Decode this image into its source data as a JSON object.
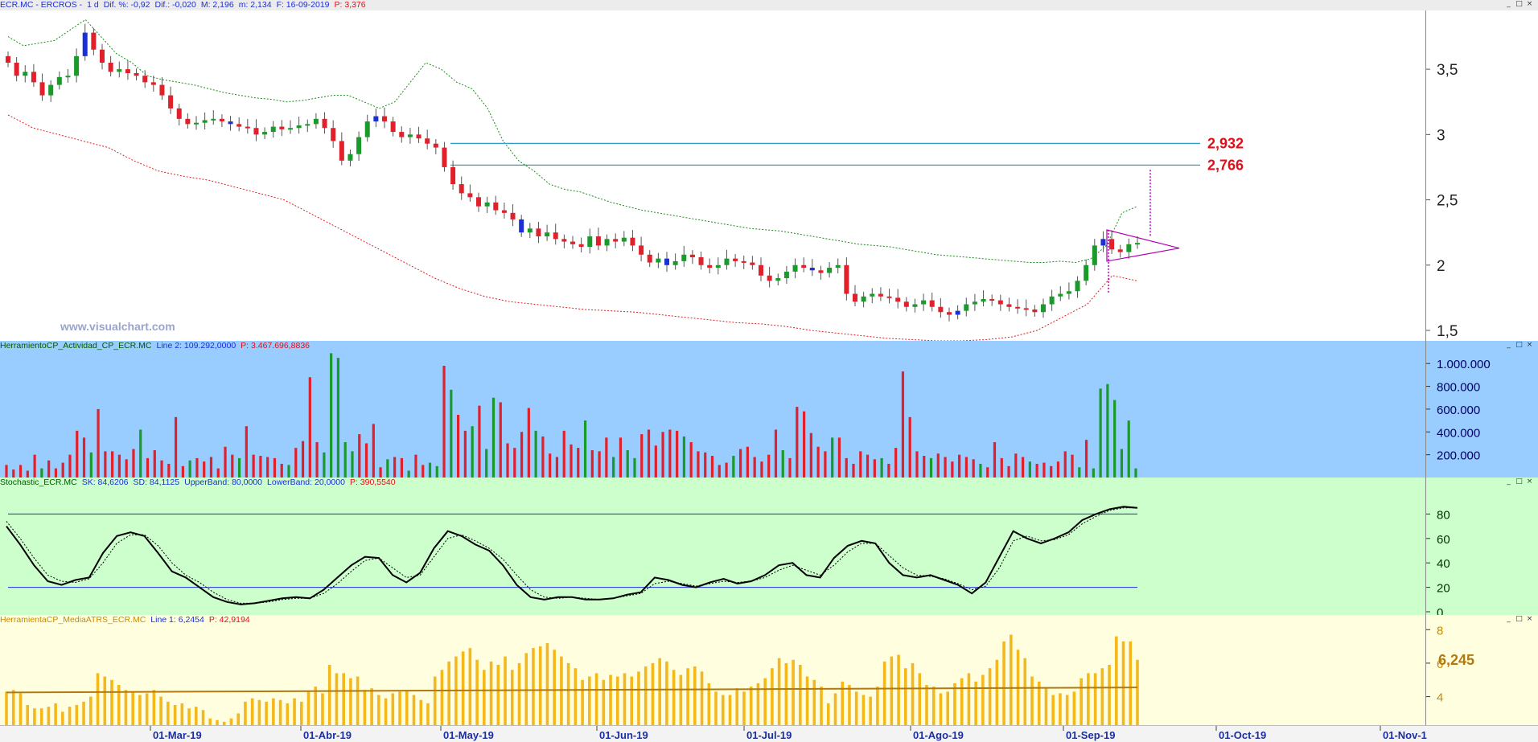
{
  "price_pane": {
    "header": {
      "symbol": "ECR.MC - ERCROS -",
      "period": "1 d",
      "dif_pct": "Dif. %: -0,92",
      "dif": "Dif.: -0,020",
      "max": "M: 2,196",
      "min": "m: 2,134",
      "date": "F: 16-09-2019",
      "p": "P: 3,376"
    },
    "watermark": "www.visualchart.com",
    "level_labels": [
      "2,932",
      "2,766"
    ]
  },
  "volume_pane": {
    "header": {
      "name": "HerramientoCP_Actividad_CP_ECR.MC",
      "line": "Line 2: 109.292,0000",
      "p": "P: 3.467.696,8836"
    }
  },
  "stoch_pane": {
    "header": {
      "name": "Stochastic_ECR.MC",
      "sk": "SK: 84,6206",
      "sd": "SD: 84,1125",
      "upper": "UpperBand: 80,0000",
      "lower": "LowerBand: 20,0000",
      "p": "P: 390,5540"
    }
  },
  "atr_pane": {
    "header": {
      "name": "HerramientaCP_MediaATRS_ECR.MC",
      "line": "Line 1: 6,2454",
      "p": "P: 42,9194"
    },
    "last_value_label": "6,245"
  },
  "window_buttons": [
    "_",
    "□",
    "×"
  ],
  "colors": {
    "candle_down": "#e0202a",
    "candle_up": "#1a9a2a",
    "candle_neutral": "#1c2fd6",
    "upper_band": "#1a8a1a",
    "lower_band": "#e02020",
    "level_line": "#2aa0c8",
    "level_label": "#e0101a",
    "triangle": "#b000b0",
    "volume_bg": "#99ccff",
    "stoch_bg": "#ccffcc",
    "atr_bg": "#ffffe0",
    "atr_bar": "#f5b81c",
    "atr_avg": "#b07a10"
  },
  "chart_data": [
    {
      "type": "candlestick",
      "title": "ECR.MC - ERCROS - 1 d",
      "x_tick_labels": [
        "01-Mar-19",
        "01-Abr-19",
        "01-May-19",
        "01-Jun-19",
        "01-Jul-19",
        "01-Ago-19",
        "01-Sep-19",
        "01-Oct-19",
        "01-Nov-1"
      ],
      "y_tick_labels": [
        "1,5",
        "2",
        "2,5",
        "3",
        "3,5"
      ],
      "ylim": [
        1.42,
        3.95
      ],
      "horizontal_levels": [
        2.932,
        2.766
      ],
      "close_approx": [
        3.55,
        3.45,
        3.48,
        3.4,
        3.3,
        3.38,
        3.44,
        3.45,
        3.6,
        3.78,
        3.65,
        3.55,
        3.48,
        3.5,
        3.47,
        3.45,
        3.4,
        3.38,
        3.3,
        3.2,
        3.12,
        3.08,
        3.09,
        3.11,
        3.12,
        3.1,
        3.08,
        3.06,
        3.05,
        3.0,
        3.02,
        3.06,
        3.04,
        3.05,
        3.07,
        3.08,
        3.12,
        3.05,
        2.95,
        2.8,
        2.85,
        2.98,
        3.1,
        3.14,
        3.1,
        3.02,
        2.98,
        3.0,
        2.97,
        2.93,
        2.9,
        2.75,
        2.62,
        2.55,
        2.52,
        2.45,
        2.48,
        2.42,
        2.4,
        2.35,
        2.25,
        2.28,
        2.22,
        2.25,
        2.2,
        2.18,
        2.16,
        2.14,
        2.22,
        2.15,
        2.2,
        2.18,
        2.21,
        2.15,
        2.08,
        2.02,
        2.05,
        2.0,
        2.03,
        2.08,
        2.06,
        2.0,
        1.98,
        2.0,
        2.05,
        2.03,
        2.02,
        2.0,
        1.92,
        1.88,
        1.9,
        1.95,
        2.0,
        1.98,
        1.96,
        1.94,
        1.98,
        2.0,
        1.78,
        1.72,
        1.76,
        1.78,
        1.76,
        1.75,
        1.72,
        1.68,
        1.7,
        1.73,
        1.68,
        1.64,
        1.62,
        1.65,
        1.7,
        1.72,
        1.74,
        1.73,
        1.7,
        1.68,
        1.67,
        1.66,
        1.64,
        1.7,
        1.76,
        1.78,
        1.8,
        1.88,
        2.0,
        2.15,
        2.2,
        2.12,
        2.1,
        2.16,
        2.17
      ],
      "band_upper_approx": [
        3.75,
        3.68,
        3.7,
        3.72,
        3.8,
        3.88,
        3.75,
        3.62,
        3.55,
        3.45,
        3.42,
        3.4,
        3.38,
        3.35,
        3.32,
        3.3,
        3.28,
        3.27,
        3.25,
        3.26,
        3.28,
        3.3,
        3.3,
        3.25,
        3.2,
        3.25,
        3.4,
        3.55,
        3.5,
        3.4,
        3.35,
        3.2,
        2.95,
        2.8,
        2.72,
        2.62,
        2.58,
        2.56,
        2.52,
        2.48,
        2.45,
        2.42,
        2.4,
        2.38,
        2.36,
        2.34,
        2.32,
        2.3,
        2.28,
        2.27,
        2.26,
        2.24,
        2.22,
        2.2,
        2.18,
        2.16,
        2.15,
        2.14,
        2.12,
        2.1,
        2.08,
        2.07,
        2.06,
        2.05,
        2.04,
        2.03,
        2.02,
        2.02,
        2.03,
        2.02,
        2.05,
        2.15,
        2.4,
        2.45
      ],
      "band_lower_approx": [
        3.15,
        3.05,
        3.0,
        2.95,
        2.9,
        2.8,
        2.72,
        2.68,
        2.65,
        2.6,
        2.55,
        2.5,
        2.4,
        2.3,
        2.2,
        2.1,
        2.0,
        1.9,
        1.82,
        1.76,
        1.72,
        1.7,
        1.68,
        1.66,
        1.65,
        1.64,
        1.62,
        1.6,
        1.58,
        1.56,
        1.55,
        1.53,
        1.5,
        1.48,
        1.46,
        1.44,
        1.43,
        1.42,
        1.42,
        1.43,
        1.45,
        1.5,
        1.6,
        1.7,
        1.92,
        1.88
      ]
    },
    {
      "type": "bar",
      "title": "HerramientoCP_Actividad_CP_ECR.MC",
      "y_tick_labels": [
        "200.000",
        "400.000",
        "600.000",
        "800.000",
        "1.000.000"
      ],
      "ylim": [
        0,
        1100000
      ],
      "values": [
        110000,
        70000,
        110000,
        60000,
        200000,
        80000,
        150000,
        80000,
        130000,
        200000,
        410000,
        350000,
        220000,
        600000,
        230000,
        230000,
        200000,
        160000,
        250000,
        420000,
        170000,
        240000,
        150000,
        120000,
        530000,
        100000,
        150000,
        170000,
        140000,
        180000,
        80000,
        270000,
        200000,
        170000,
        450000,
        200000,
        190000,
        180000,
        170000,
        120000,
        110000,
        260000,
        320000,
        880000,
        310000,
        220000,
        1090000,
        1050000,
        310000,
        230000,
        380000,
        300000,
        470000,
        90000,
        160000,
        180000,
        170000,
        60000,
        200000,
        110000,
        130000,
        100000,
        980000,
        770000,
        550000,
        410000,
        450000,
        630000,
        250000,
        700000,
        660000,
        300000,
        260000,
        400000,
        610000,
        410000,
        360000,
        210000,
        180000,
        410000,
        290000,
        260000,
        500000,
        240000,
        230000,
        350000,
        180000,
        350000,
        240000,
        170000,
        380000,
        420000,
        280000,
        400000,
        420000,
        410000,
        360000,
        310000,
        230000,
        220000,
        190000,
        110000,
        130000,
        190000,
        250000,
        270000,
        180000,
        140000,
        200000,
        420000,
        240000,
        170000,
        620000,
        580000,
        390000,
        270000,
        230000,
        350000,
        350000,
        170000,
        120000,
        230000,
        200000,
        160000,
        170000,
        120000,
        260000,
        930000,
        530000,
        230000,
        190000,
        170000,
        210000,
        180000,
        140000,
        200000,
        180000,
        160000,
        120000,
        90000,
        310000,
        170000,
        100000,
        210000,
        180000,
        140000,
        120000,
        130000,
        100000,
        140000,
        230000,
        200000,
        90000,
        330000,
        80000,
        780000,
        820000,
        680000,
        250000,
        500000,
        80000
      ]
    },
    {
      "type": "line",
      "title": "Stochastic_ECR.MC",
      "y_tick_labels": [
        "0",
        "20",
        "40",
        "60",
        "80"
      ],
      "ylim": [
        0,
        100
      ],
      "bands": [
        80,
        20
      ],
      "series": [
        {
          "name": "SK",
          "values": [
            70,
            55,
            38,
            25,
            22,
            26,
            28,
            48,
            62,
            65,
            62,
            48,
            33,
            28,
            20,
            12,
            8,
            6,
            7,
            9,
            11,
            12,
            11,
            18,
            28,
            38,
            45,
            44,
            30,
            24,
            32,
            52,
            66,
            62,
            55,
            50,
            38,
            22,
            12,
            10,
            12,
            12,
            10,
            10,
            11,
            14,
            16,
            28,
            26,
            22,
            20,
            24,
            27,
            23,
            25,
            30,
            38,
            40,
            30,
            28,
            44,
            54,
            58,
            56,
            40,
            30,
            28,
            30,
            26,
            22,
            15,
            24,
            45,
            66,
            60,
            56,
            60,
            65,
            75,
            80,
            84,
            86,
            85
          ]
        },
        {
          "name": "SD",
          "values": [
            74,
            60,
            44,
            30,
            25,
            24,
            27,
            40,
            56,
            63,
            63,
            54,
            40,
            30,
            24,
            16,
            10,
            7,
            7,
            8,
            10,
            11,
            11,
            15,
            23,
            33,
            42,
            44,
            36,
            28,
            30,
            45,
            60,
            63,
            58,
            52,
            43,
            30,
            18,
            12,
            11,
            12,
            11,
            10,
            11,
            13,
            15,
            23,
            25,
            23,
            21,
            23,
            25,
            24,
            25,
            28,
            34,
            38,
            34,
            30,
            38,
            49,
            56,
            56,
            46,
            36,
            30,
            29,
            27,
            23,
            18,
            21,
            36,
            58,
            62,
            58,
            59,
            63,
            72,
            78,
            83,
            85,
            85
          ]
        }
      ]
    },
    {
      "type": "bar",
      "title": "HerramientaCP_MediaATRS_ECR.MC",
      "y_tick_labels": [
        "4",
        "6",
        "8"
      ],
      "ylim": [
        2.3,
        8.3
      ],
      "values": [
        4.3,
        4.4,
        4.2,
        3.5,
        3.3,
        3.3,
        3.4,
        3.6,
        3.1,
        3.4,
        3.5,
        3.7,
        4.0,
        5.4,
        5.2,
        5.0,
        4.7,
        4.4,
        4.3,
        4.1,
        4.2,
        4.4,
        4.0,
        3.7,
        3.5,
        3.6,
        3.3,
        3.4,
        3.2,
        2.7,
        2.6,
        2.5,
        2.7,
        3.0,
        3.7,
        3.9,
        3.8,
        3.7,
        3.9,
        3.8,
        3.6,
        3.9,
        3.7,
        4.3,
        4.6,
        4.2,
        5.9,
        5.4,
        5.4,
        5.1,
        5.2,
        4.4,
        4.5,
        4.1,
        3.9,
        4.2,
        4.3,
        4.4,
        4.1,
        3.8,
        3.6,
        5.2,
        5.6,
        6.1,
        6.4,
        6.7,
        6.9,
        6.2,
        5.6,
        6.1,
        5.9,
        6.4,
        5.6,
        6.0,
        6.6,
        6.9,
        7.0,
        7.2,
        6.8,
        6.4,
        6.0,
        5.7,
        5.0,
        5.2,
        5.4,
        5.0,
        5.3,
        5.2,
        5.4,
        5.2,
        5.5,
        5.8,
        6.0,
        6.3,
        6.1,
        5.6,
        5.3,
        5.7,
        5.8,
        5.5,
        4.8,
        4.3,
        4.1,
        4.1,
        4.5,
        4.3,
        4.6,
        4.8,
        5.1,
        5.7,
        6.3,
        6.0,
        6.2,
        5.9,
        5.2,
        5.0,
        4.6,
        3.6,
        4.2,
        4.9,
        4.7,
        4.3,
        4.1,
        4.0,
        4.6,
        6.1,
        6.4,
        6.5,
        5.7,
        6.0,
        5.4,
        4.7,
        4.6,
        4.2,
        4.3,
        4.8,
        5.1,
        5.4,
        4.9,
        5.3,
        5.7,
        6.2,
        7.3,
        7.7,
        6.8,
        6.3,
        5.2,
        4.9,
        4.5,
        4.1,
        4.2,
        4.1,
        4.3,
        5.1,
        5.4,
        5.4,
        5.7,
        5.9,
        7.6,
        7.3,
        7.3,
        6.2
      ]
    }
  ]
}
